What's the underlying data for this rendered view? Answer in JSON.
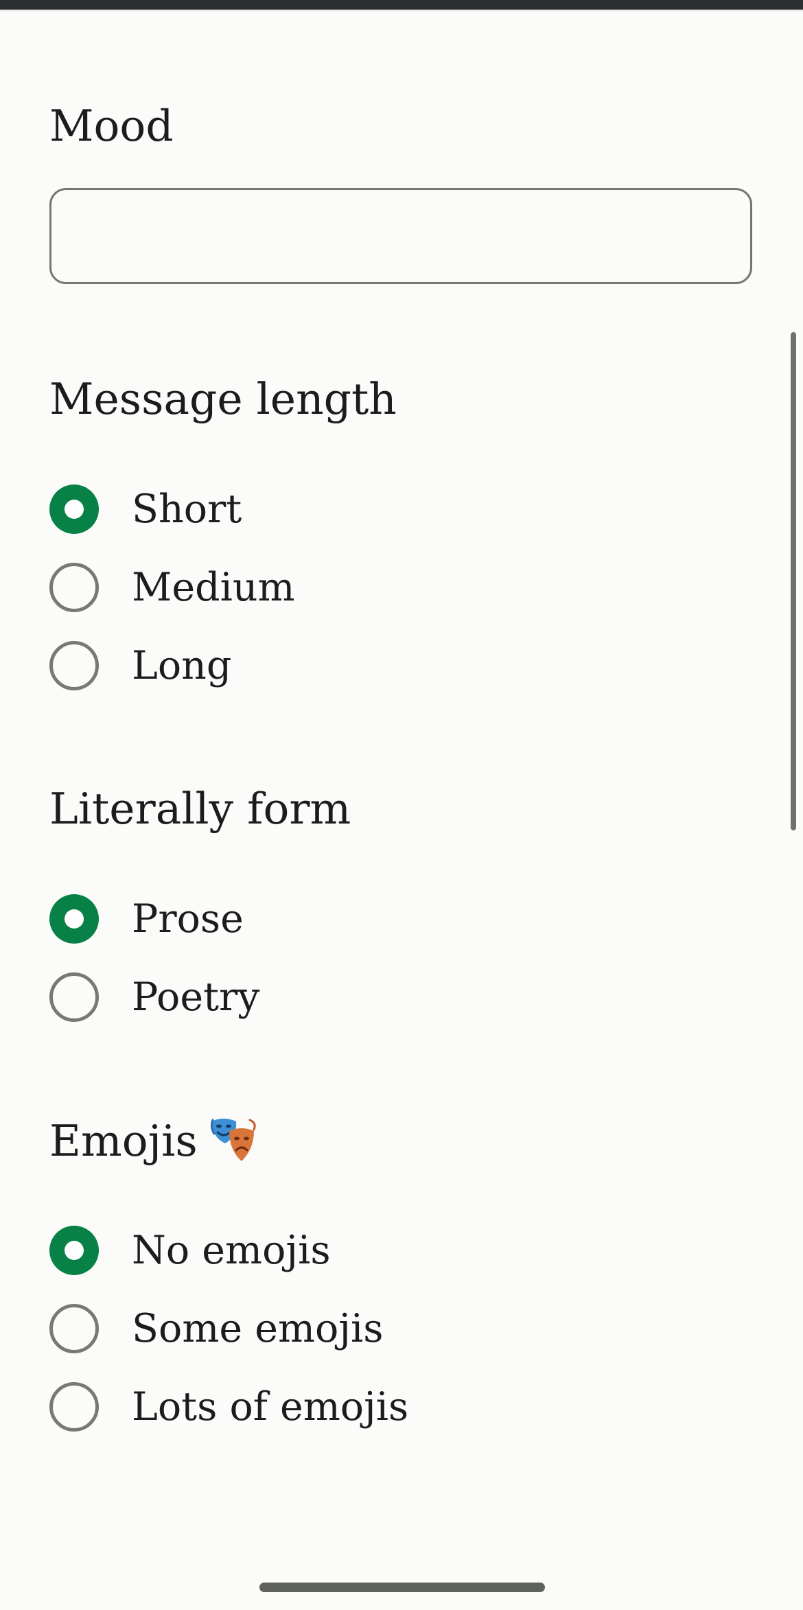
{
  "mood": {
    "title": "Mood",
    "value": ""
  },
  "message_length": {
    "title": "Message length",
    "options": [
      {
        "label": "Short",
        "selected": true
      },
      {
        "label": "Medium",
        "selected": false
      },
      {
        "label": "Long",
        "selected": false
      }
    ]
  },
  "literary_form": {
    "title": "Literally form",
    "options": [
      {
        "label": "Prose",
        "selected": true
      },
      {
        "label": "Poetry",
        "selected": false
      }
    ]
  },
  "emojis": {
    "title": "Emojis",
    "title_icon": "performing-arts-masks-icon",
    "options": [
      {
        "label": "No emojis",
        "selected": true
      },
      {
        "label": "Some emojis",
        "selected": false
      },
      {
        "label": "Lots of emojis",
        "selected": false
      }
    ]
  },
  "colors": {
    "accent": "#078145",
    "background": "#fbfcfa",
    "text": "#1b1c1b",
    "outline": "#757775"
  }
}
